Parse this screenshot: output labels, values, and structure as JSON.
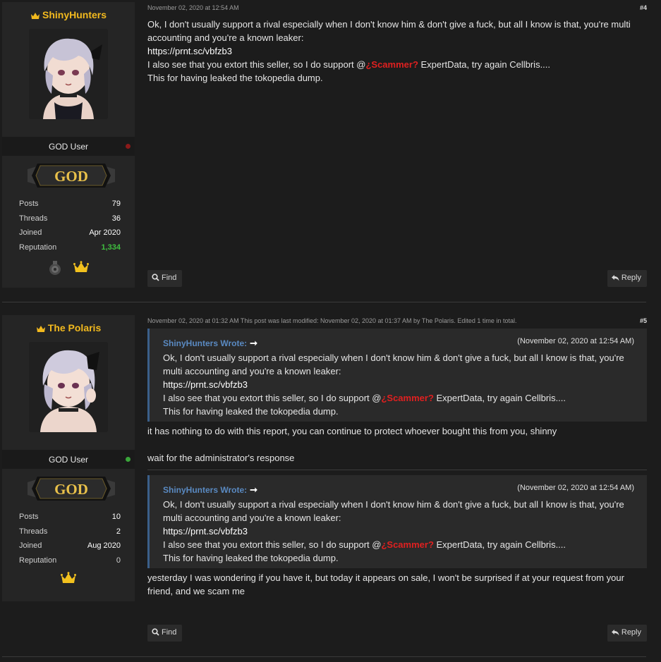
{
  "posts": [
    {
      "number": "#4",
      "meta": "November 02, 2020 at 12:54 AM",
      "author": {
        "name": "ShinyHunters",
        "usertitle": "GOD User",
        "rank_badge": "GOD",
        "status": "offline",
        "status_color": "#8b1a1a",
        "stats": [
          {
            "label": "Posts",
            "value": "79"
          },
          {
            "label": "Threads",
            "value": "36"
          },
          {
            "label": "Joined",
            "value": "Apr 2020"
          },
          {
            "label": "Reputation",
            "value": "1,334"
          }
        ],
        "awards": [
          "bomb-award-icon",
          "crown-award-icon"
        ]
      },
      "content": {
        "line1": "Ok, I don't usually support a rival especially when I don't know him & don't give a fuck, but all I know is that, you're multi accounting and you're a known leaker:",
        "link": "https://prnt.sc/vbfzb3",
        "line3_before": "I also see that you extort this seller, so I do support @",
        "scam_tag": "¿Scammer?",
        "line3_after": " ExpertData, try again Cellbris....",
        "line4": "This for having leaked the tokopedia dump."
      },
      "buttons": {
        "find": "Find",
        "reply": "Reply"
      }
    },
    {
      "number": "#5",
      "meta": "November 02, 2020 at 01:32 AM  This post was last modified: November 02, 2020 at 01:37 AM by The Polaris. Edited 1 time in total.",
      "author": {
        "name": "The Polaris",
        "usertitle": "GOD User",
        "rank_badge": "GOD",
        "status": "online",
        "status_color": "#3aa63a",
        "stats": [
          {
            "label": "Posts",
            "value": "10"
          },
          {
            "label": "Threads",
            "value": "2"
          },
          {
            "label": "Joined",
            "value": "Aug 2020"
          },
          {
            "label": "Reputation",
            "value": "0"
          }
        ],
        "awards": [
          "crown-award-icon"
        ]
      },
      "quotes": [
        {
          "author": "ShinyHunters Wrote:",
          "arrow": "➞",
          "date": "(November 02, 2020 at 12:54 AM)",
          "line1": "Ok, I don't usually support a rival especially when I don't know him & don't give a fuck, but all I know is that, you're multi accounting and you're a known leaker:",
          "link": "https://prnt.sc/vbfzb3",
          "line3_before": "I also see that you extort this seller, so I do support @",
          "scam_tag": "¿Scammer?",
          "line3_after": " ExpertData, try again Cellbris....",
          "line4": "This for having leaked the tokopedia dump."
        },
        {
          "author": "ShinyHunters Wrote:",
          "arrow": "➞",
          "date": "(November 02, 2020 at 12:54 AM)",
          "line1": "Ok, I don't usually support a rival especially when I don't know him & don't give a fuck, but all I know is that, you're multi accounting and you're a known leaker:",
          "link": "https://prnt.sc/vbfzb3",
          "line3_before": "I also see that you extort this seller, so I do support @",
          "scam_tag": "¿Scammer?",
          "line3_after": " ExpertData, try again Cellbris....",
          "line4": "This for having leaked the tokopedia dump."
        }
      ],
      "reply_text_1": "it has nothing to do with this report, you can continue to protect whoever bought this from you, shinny",
      "reply_text_2": "wait for the administrator's response",
      "reply_text_3": "yesterday I was wondering if you have it, but today it appears on sale, I won't be surprised if at your request from your friend, and we scam me",
      "buttons": {
        "find": "Find",
        "reply": "Reply"
      }
    }
  ],
  "colors": {
    "username": "#f2b91e",
    "quote_author": "#5a8ac2",
    "scam_tag": "#e02020",
    "reputation_positive": "#3fbf3f"
  }
}
